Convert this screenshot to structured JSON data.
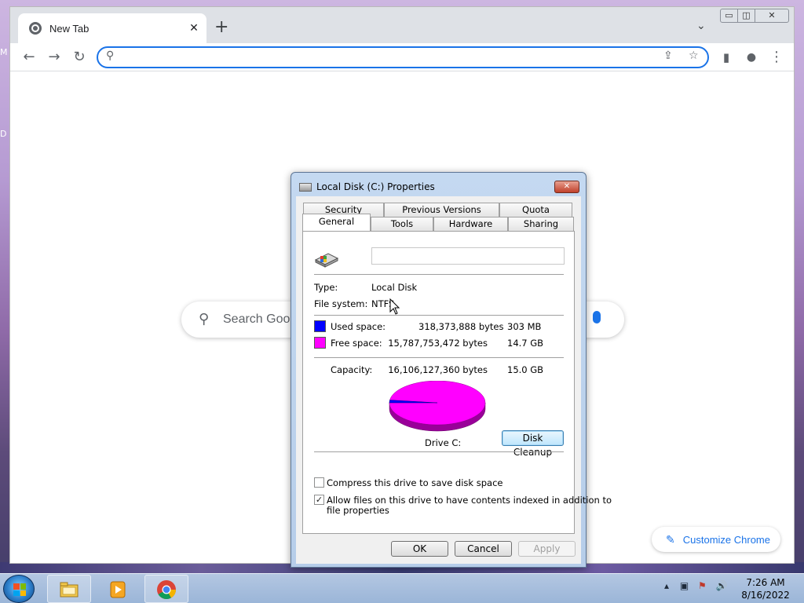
{
  "desktop": {
    "edge_letters": [
      "M",
      "D"
    ]
  },
  "browser": {
    "tab_title": "New Tab",
    "new_tab_label": "+",
    "address_value": "",
    "ntp_search_placeholder": "Search Google or type a URL",
    "customize_label": "Customize Chrome"
  },
  "dialog": {
    "title": "Local Disk (C:) Properties",
    "close_label": "✕",
    "tabs_back": [
      "Security",
      "Previous Versions",
      "Quota"
    ],
    "tabs_front": [
      "General",
      "Tools",
      "Hardware",
      "Sharing"
    ],
    "active_tab": "General",
    "volume_name": "",
    "type_label": "Type:",
    "type_value": "Local Disk",
    "fs_label": "File system:",
    "fs_value": "NTFS",
    "used_label": "Used space:",
    "used_bytes": "318,373,888 bytes",
    "used_size": "303 MB",
    "free_label": "Free space:",
    "free_bytes": "15,787,753,472 bytes",
    "free_size": "14.7 GB",
    "capacity_label": "Capacity:",
    "capacity_bytes": "16,106,127,360 bytes",
    "capacity_size": "15.0 GB",
    "drive_label": "Drive C:",
    "disk_cleanup_label": "Disk Cleanup",
    "compress_label": "Compress this drive to save disk space",
    "compress_checked": false,
    "index_label_line1": "Allow files on this drive to have contents indexed in addition to",
    "index_label_line2": "file properties",
    "index_checked": true,
    "ok_label": "OK",
    "cancel_label": "Cancel",
    "apply_label": "Apply",
    "used_fraction": 0.0198,
    "colors": {
      "used": "#0000ff",
      "free": "#ff00ff"
    }
  },
  "taskbar": {
    "time": "7:26 AM",
    "date": "8/16/2022"
  }
}
